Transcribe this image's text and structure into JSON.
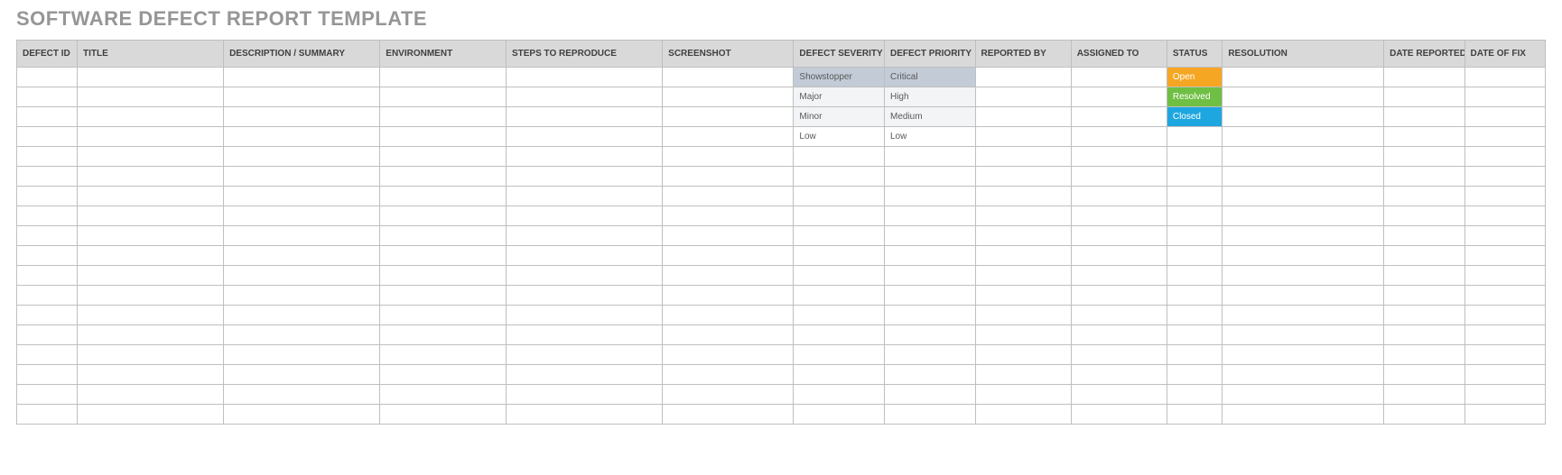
{
  "title": "SOFTWARE DEFECT REPORT TEMPLATE",
  "columns": [
    "DEFECT ID",
    "TITLE",
    "DESCRIPTION / SUMMARY",
    "ENVIRONMENT",
    "STEPS TO REPRODUCE",
    "SCREENSHOT",
    "DEFECT SEVERITY",
    "DEFECT PRIORITY",
    "REPORTED BY",
    "ASSIGNED TO",
    "STATUS",
    "RESOLUTION",
    "DATE REPORTED",
    "DATE OF FIX"
  ],
  "rows": [
    {
      "severity": "Showstopper",
      "priority": "Critical",
      "status": "Open",
      "severity_shade": "dark",
      "priority_shade": "dark",
      "status_class": "status-open"
    },
    {
      "severity": "Major",
      "priority": "High",
      "status": "Resolved",
      "severity_shade": "light",
      "priority_shade": "light",
      "status_class": "status-resolved"
    },
    {
      "severity": "Minor",
      "priority": "Medium",
      "status": "Closed",
      "severity_shade": "light",
      "priority_shade": "light",
      "status_class": "status-closed"
    },
    {
      "severity": "Low",
      "priority": "Low",
      "status": "",
      "severity_shade": "",
      "priority_shade": "",
      "status_class": ""
    },
    {},
    {},
    {},
    {},
    {},
    {},
    {},
    {},
    {},
    {},
    {},
    {},
    {},
    {}
  ]
}
